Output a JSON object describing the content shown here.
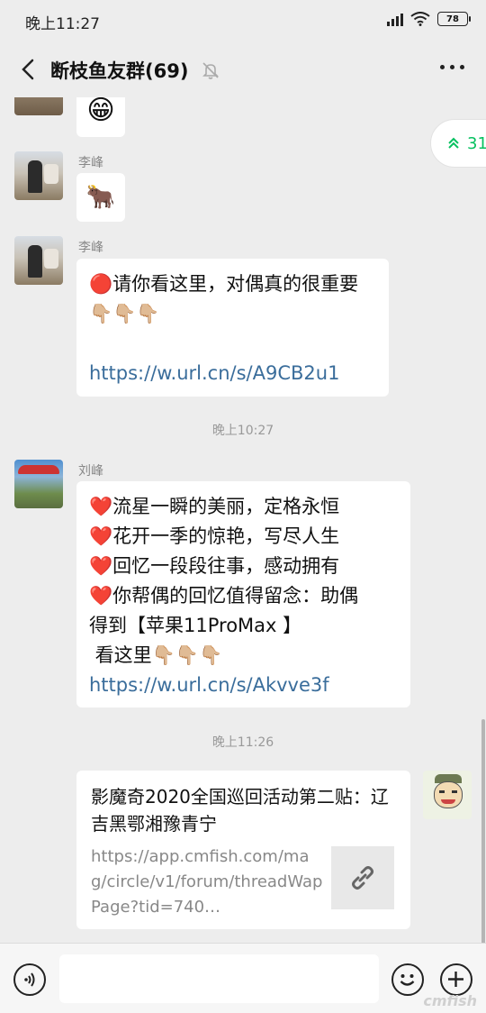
{
  "status": {
    "time": "晚上11:27",
    "battery": "78"
  },
  "header": {
    "title": "断枝鱼友群(69)"
  },
  "unread": {
    "count": "31"
  },
  "messages": [
    {
      "sender": "",
      "emoji": "😁"
    },
    {
      "sender": "李峰",
      "emoji": "🐂"
    },
    {
      "sender": "李峰",
      "lines": [
        "🔴请你看这里，对偶真的很重要",
        "👇🏼👇🏼👇🏼",
        "https://w.url.cn/s/A9CB2u1"
      ]
    },
    {
      "sender": "刘峰",
      "lines": [
        "❤️流星一瞬的美丽，定格永恒",
        "❤️花开一季的惊艳，写尽人生",
        "❤️回忆一段段往事，感动拥有",
        "❤️你帮偶的回忆值得留念：助偶",
        "得到【苹果11ProMax 】",
        " 看这里👇🏼👇🏼👇🏼",
        "https://w.url.cn/s/Akvve3f"
      ]
    }
  ],
  "timestamps": [
    "晚上10:27",
    "晚上11:26"
  ],
  "card": {
    "title": "影魔奇2020全国巡回活动第二贴：辽吉黑鄂湘豫青宁",
    "url": "https://app.cmfish.com/mag/circle/v1/forum/threadWapPage?tid=740…"
  },
  "watermark": "cmfish",
  "icons": {
    "back": "back-arrow-icon",
    "mute": "mute-bell-icon",
    "more": "more-icon",
    "voice": "voice-icon",
    "emoji": "emoji-icon",
    "plus": "plus-icon",
    "link": "link-icon"
  }
}
